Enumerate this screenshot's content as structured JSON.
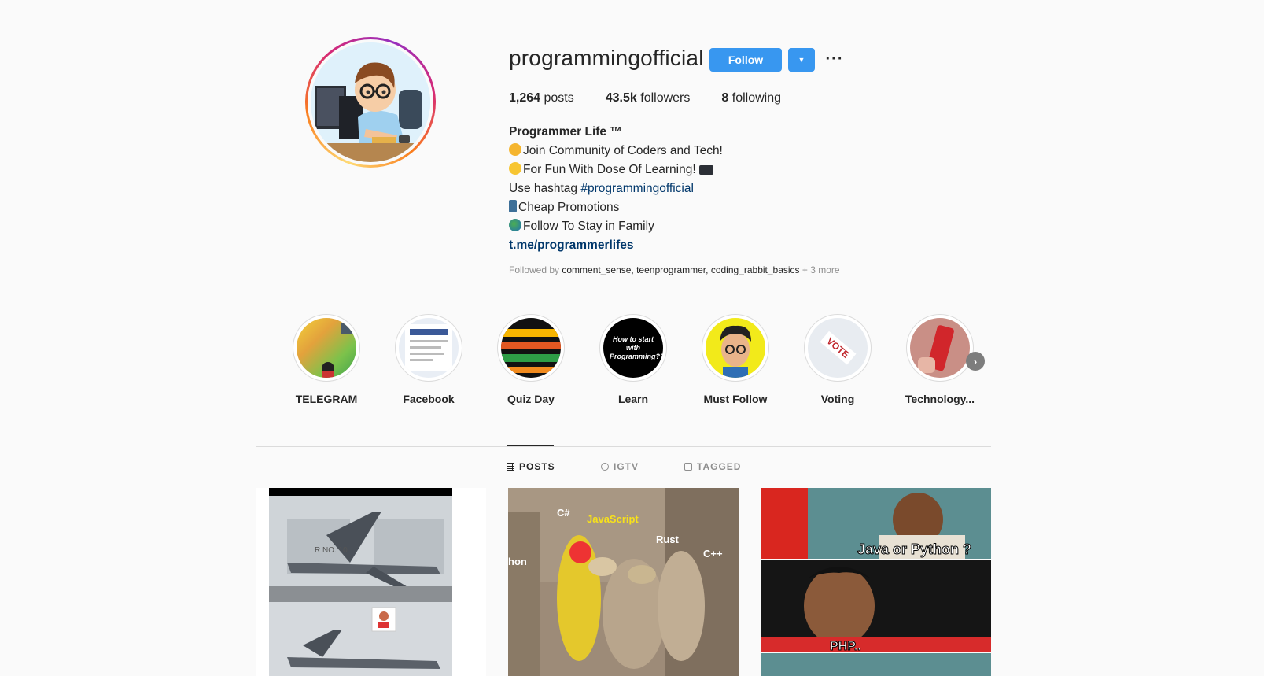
{
  "profile": {
    "username": "programmingofficial",
    "follow_label": "Follow",
    "dropdown_icon": "chevron-down-icon",
    "more_icon": "ellipsis-icon",
    "stats": {
      "posts_count": "1,264",
      "posts_label": "posts",
      "followers_count": "43.5k",
      "followers_label": "followers",
      "following_count": "8",
      "following_label": "following"
    },
    "bio": {
      "name": "Programmer Life ™",
      "line1": "Join Community of Coders and Tech!",
      "line2": "For Fun With Dose Of Learning!",
      "line3_prefix": "Use hashtag ",
      "line3_tag": "#programmingofficial",
      "line4": "Cheap Promotions",
      "line5": "Follow To Stay in Family",
      "link": "t.me/programmerlifes"
    },
    "followed_by": {
      "prefix": "Followed by ",
      "user1": "comment_sense",
      "sep1": ", ",
      "user2": "teenprogrammer",
      "sep2": ", ",
      "user3": "coding_rabbit_basics",
      "more": " + 3 more"
    }
  },
  "highlights": [
    {
      "label": "TELEGRAM"
    },
    {
      "label": "Facebook"
    },
    {
      "label": "Quiz Day"
    },
    {
      "label": "Learn",
      "text": "How to start with Programming???"
    },
    {
      "label": "Must Follow"
    },
    {
      "label": "Voting",
      "text": "VOTE"
    },
    {
      "label": "Technology..."
    }
  ],
  "tabs": {
    "posts": "POSTS",
    "igtv": "IGTV",
    "tagged": "TAGGED"
  },
  "posts": {
    "post1_text": "R NO. 10",
    "post2_labels": [
      "C#",
      "JavaScript",
      "Rust",
      "C++",
      "hon"
    ],
    "post3_top": "Java or Python ?",
    "post3_bottom": "PHP.."
  },
  "colors": {
    "accent": "#3897f0",
    "link": "#00376b",
    "muted": "#8e8e8e"
  }
}
